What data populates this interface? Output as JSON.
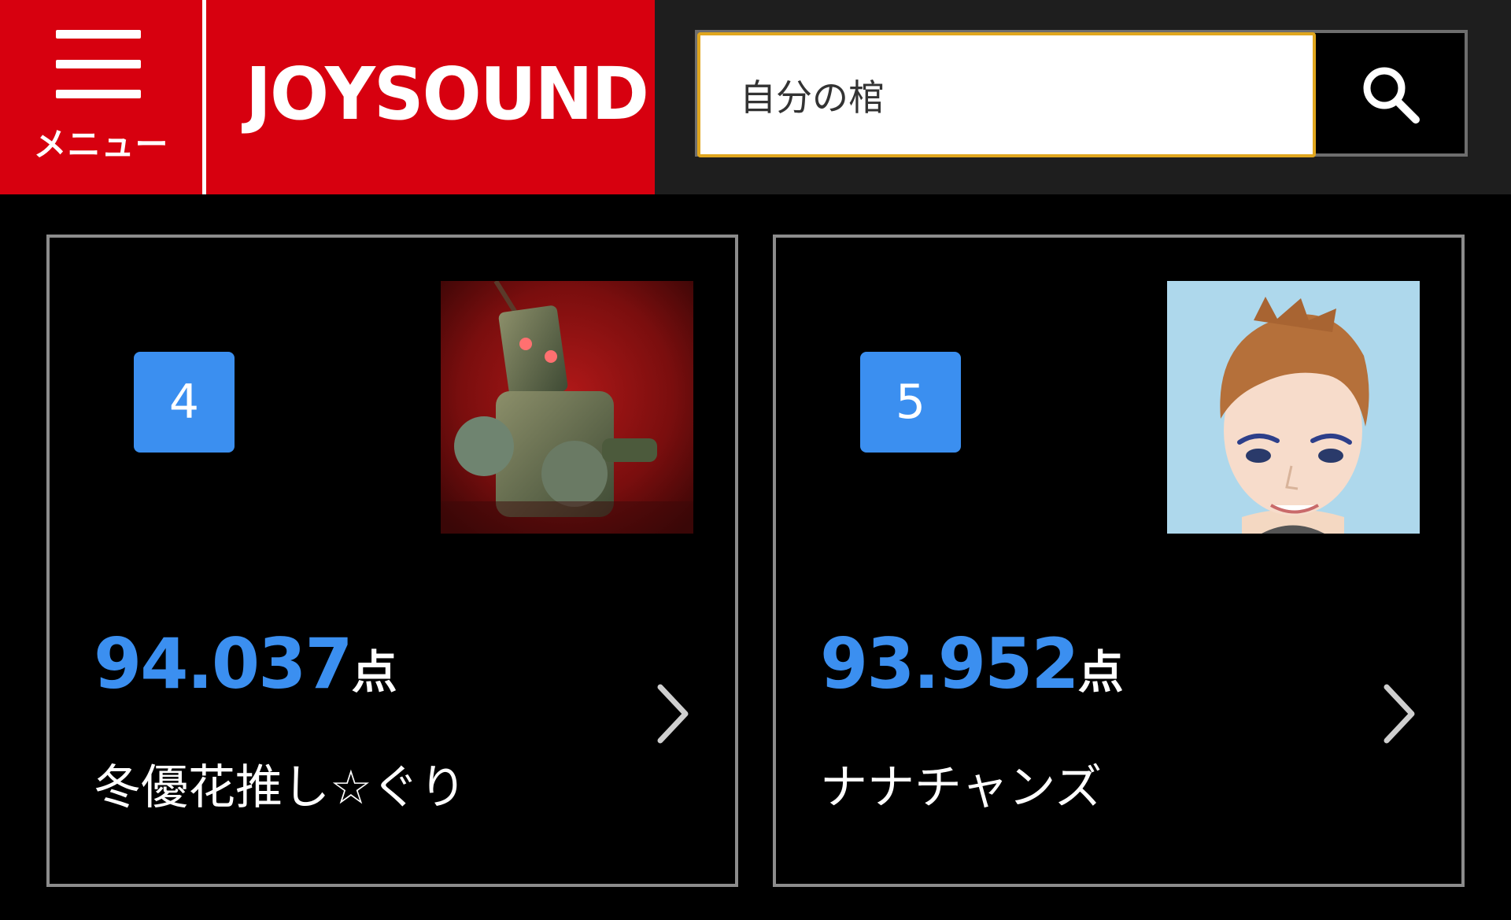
{
  "header": {
    "menu_label": "メニュー",
    "logo_text": "JOYSOUND",
    "search": {
      "value": "自分の棺",
      "placeholder": ""
    }
  },
  "cards": [
    {
      "rank": "4",
      "score": "94.037",
      "score_unit": "点",
      "name": "冬優花推し☆ぐり",
      "avatar": "robot-avatar"
    },
    {
      "rank": "5",
      "score": "93.952",
      "score_unit": "点",
      "name": "ナナチャンズ",
      "avatar": "boy-avatar"
    }
  ],
  "colors": {
    "brand_red": "#d7000f",
    "accent_blue": "#3b8ff0",
    "search_border": "#e0a61e"
  }
}
